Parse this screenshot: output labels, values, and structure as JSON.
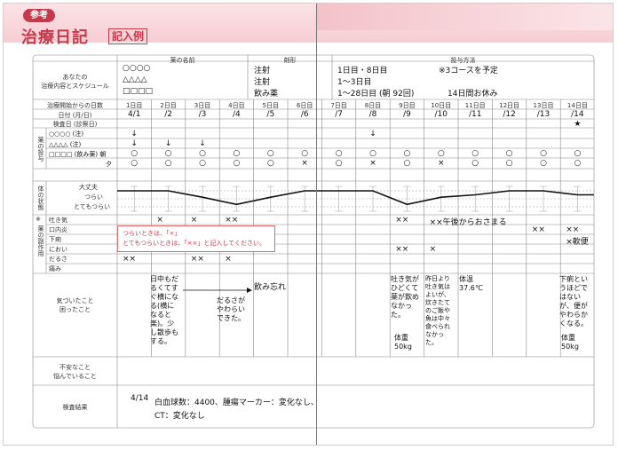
{
  "header": {
    "ref_badge": "参考",
    "title": "治療日記",
    "example_label": "記入例"
  },
  "plan": {
    "col_drug": "薬の名前",
    "col_method": "剤形",
    "col_schedule": "投与方法",
    "row_label_1": "あなたの",
    "row_label_2": "治療内容とスケジュール",
    "drug_1": "○○○○",
    "drug_2": "△△△△",
    "drug_3": "□□□□",
    "form_1": "注射",
    "form_2": "注射",
    "form_3": "飲み薬",
    "sched_1": "1日目・8日目",
    "sched_2": "1〜3日目",
    "sched_3": "1〜28日目 (朝 92回)",
    "sched_note_1": "※3コースを予定",
    "sched_note_2": "14日間お休み"
  },
  "days": {
    "days_label": "治療開始からの日数",
    "date_label": "日付 (月/日)",
    "check_label": "検査日 (診察日)",
    "day_numbers": [
      "1日目",
      "2日目",
      "3日目",
      "4日目",
      "5日目",
      "6日目",
      "7日目",
      "8日目",
      "9日目",
      "10日目",
      "11日目",
      "12日目",
      "13日目",
      "14日目"
    ],
    "dates": [
      "4/1",
      "/2",
      "/3",
      "/4",
      "/5",
      "/6",
      "/7",
      "/8",
      "/9",
      "/10",
      "/11",
      "/12",
      "/13",
      "/14"
    ]
  },
  "dosing": {
    "section_label": "薬の投与",
    "rows": [
      "○○○○ (注)",
      "△△△△ (注)",
      "□□□□ (飲み薬) 朝",
      "夕"
    ],
    "marks": [
      [
        "↓",
        "",
        "",
        "",
        "",
        "",
        "",
        "↓",
        "",
        "",
        "",
        "",
        "",
        ""
      ],
      [
        "↓",
        "↓",
        "↓",
        "",
        "",
        "",
        "",
        "",
        "",
        "",
        "",
        "",
        "",
        ""
      ],
      [
        "○",
        "○",
        "○",
        "○",
        "○",
        "○",
        "○",
        "○",
        "○",
        "○",
        "○",
        "○",
        "○",
        "○"
      ],
      [
        "○",
        "○",
        "○",
        "○",
        "○",
        "×",
        "○",
        "×",
        "○",
        "×",
        "○",
        "○",
        "○",
        "○"
      ]
    ],
    "star_day": 14
  },
  "condition": {
    "section_label": "体の状態",
    "levels": [
      "大丈夫",
      "つらい",
      "とてもつらい"
    ],
    "curve": [
      2,
      2,
      1.2,
      0.3,
      1.2,
      2,
      2,
      2,
      0.3,
      1.2,
      1.5,
      2,
      2,
      1.5
    ]
  },
  "side_effects": {
    "section_label": "薬の副作用",
    "footnote": "※",
    "rows": [
      "吐き気",
      "口内炎",
      "下痢",
      "におい",
      "だるさ",
      "痛み"
    ],
    "nausea": [
      "",
      "×",
      "×",
      "××",
      "",
      "",
      "",
      "",
      "××",
      "××午後からおさまる",
      "",
      "",
      "",
      ""
    ],
    "mouth": [
      "",
      "",
      "",
      "",
      "",
      "",
      "",
      "",
      "",
      "",
      "",
      "",
      "××",
      "××"
    ],
    "diarrhea": [
      "",
      "",
      "",
      "",
      "",
      "",
      "",
      "",
      "",
      "",
      "",
      "",
      "",
      "×軟便"
    ],
    "smell": [
      "",
      "",
      "",
      "",
      "",
      "",
      "",
      "",
      "××",
      "×",
      "",
      "",
      "",
      ""
    ],
    "fatigue": [
      "××",
      "",
      "××",
      "×",
      "",
      "",
      "",
      "",
      "",
      "",
      "",
      "",
      "",
      ""
    ],
    "callout_line_1": "つらいときは、「×」",
    "callout_line_2": "とてもつらいときは、「××」と記入してください。"
  },
  "notes": {
    "noticed_1": "気づいたこと",
    "noticed_2": "困ったこと",
    "worry_1": "不安なこと",
    "worry_2": "悩んでいること",
    "d1": "日中もだるくてすぐ横になる(横になると楽)。少し散歩もする。",
    "d4": "だるさがやわらいできた。",
    "d5": "飲み忘れ",
    "d9": "吐き気がひどくて薬が飲めなかった。",
    "d9_weight": "体重 50kg",
    "d10": "昨日より吐き気はよいが、炊きたてのご飯や魚は中々食べられなかった。",
    "d11": "体温 37.6℃",
    "d14": "下痢というほどではないが、便がやわらかくなる。",
    "d14_weight": "体重 50kg"
  },
  "results": {
    "label": "検査結果",
    "date": "4/14",
    "line_1": "白血球数：4400、腫瘍マーカー：変化なし、",
    "line_2": "CT：変化なし"
  }
}
